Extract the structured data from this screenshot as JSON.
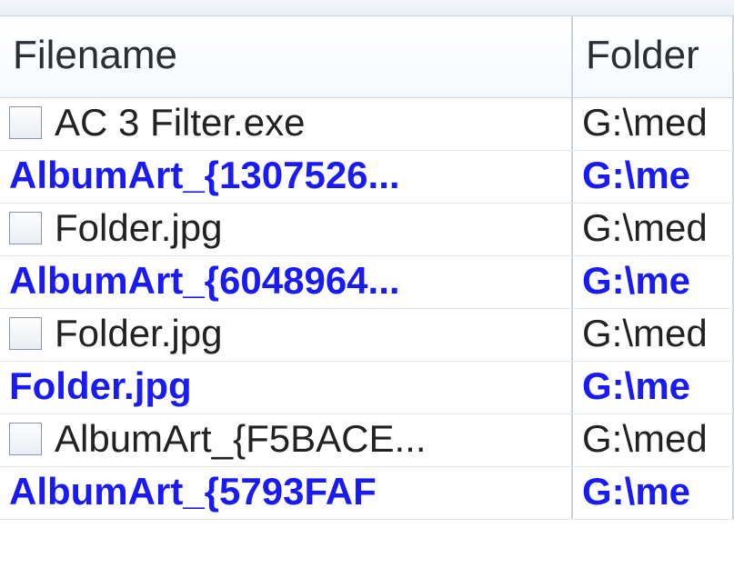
{
  "columns": {
    "filename": "Filename",
    "folder": "Folder"
  },
  "rows": [
    {
      "style": "normal",
      "filename": "AC 3 Filter.exe",
      "folder": "G:\\med"
    },
    {
      "style": "blue",
      "filename": "AlbumArt_{1307526...",
      "folder": "G:\\me"
    },
    {
      "style": "normal",
      "filename": "Folder.jpg",
      "folder": "G:\\med"
    },
    {
      "style": "blue",
      "filename": "AlbumArt_{6048964...",
      "folder": "G:\\me"
    },
    {
      "style": "normal",
      "filename": "Folder.jpg",
      "folder": "G:\\med"
    },
    {
      "style": "blue",
      "filename": "Folder.jpg",
      "folder": "G:\\me"
    },
    {
      "style": "normal",
      "filename": "AlbumArt_{F5BACE...",
      "folder": "G:\\med"
    },
    {
      "style": "blue",
      "filename": "AlbumArt_{5793FAF",
      "folder": "G:\\me"
    }
  ]
}
